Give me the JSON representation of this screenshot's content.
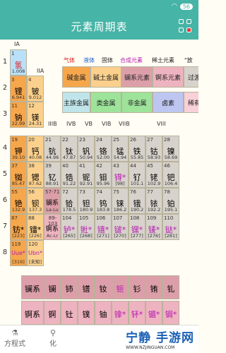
{
  "status_bar": {
    "time": "",
    "battery": "56"
  },
  "app": {
    "title": "元素周期表"
  },
  "legend": {
    "gas": "气体",
    "liquid": "液体",
    "solid": "固体",
    "synthetic": "合成元素",
    "rare_earth": "稀土元素",
    "radioactive": "\"放"
  },
  "colors": {
    "accent": "#46b4a6",
    "alkali": "#f6a64b",
    "alkaline_earth": "#fbd08c",
    "lanthanide": "#dc9fa9",
    "actinide": "#eeb3c0",
    "transition": "#d7d2cb",
    "poor_metal": "#bfe4ea",
    "nonmetal": "#9ee39a",
    "halogen": "#bdc6f0",
    "noble": "#f8d0d8",
    "hydrogen": "#b8e0f8"
  },
  "periods": [
    "1",
    "2",
    "3",
    "4",
    "5",
    "6",
    "7",
    "8"
  ],
  "groups": {
    "g1": "IA",
    "g2": "IIA",
    "g3": "IIIB",
    "g4": "IVB",
    "g5": "VB",
    "g6": "VIB",
    "g7": "VIIB",
    "g8": "VIII"
  },
  "categories": [
    "碱金属",
    "碱土金属",
    "镧系元素",
    "锕系元素",
    "过渡",
    "主族金属",
    "类金属",
    "非金属",
    "卤素",
    "稀有"
  ],
  "elements": [
    {
      "z": "1",
      "s": "氢",
      "m": "1.008"
    },
    {
      "z": "3",
      "s": "锂",
      "m": "6.941"
    },
    {
      "z": "4",
      "s": "铍",
      "m": "9.012"
    },
    {
      "z": "11",
      "s": "钠",
      "m": "22.99"
    },
    {
      "z": "12",
      "s": "镁",
      "m": "24.31"
    },
    {
      "z": "19",
      "s": "钾",
      "m": "39.10"
    },
    {
      "z": "20",
      "s": "钙",
      "m": "40.08"
    },
    {
      "z": "21",
      "s": "钪",
      "m": "44.96"
    },
    {
      "z": "22",
      "s": "钛",
      "m": "47.87"
    },
    {
      "z": "23",
      "s": "钒",
      "m": "50.94"
    },
    {
      "z": "24",
      "s": "铬",
      "m": "52.00"
    },
    {
      "z": "25",
      "s": "锰",
      "m": "54.94"
    },
    {
      "z": "26",
      "s": "铁",
      "m": "55.85"
    },
    {
      "z": "27",
      "s": "钴",
      "m": "58.93"
    },
    {
      "z": "28",
      "s": "镍",
      "m": "58.69"
    },
    {
      "z": "37",
      "s": "铷",
      "m": "85.47"
    },
    {
      "z": "38",
      "s": "锶",
      "m": "87.62"
    },
    {
      "z": "39",
      "s": "钇",
      "m": "88.91"
    },
    {
      "z": "40",
      "s": "锆",
      "m": "91.22"
    },
    {
      "z": "41",
      "s": "铌",
      "m": "92.91"
    },
    {
      "z": "42",
      "s": "钼",
      "m": "95.96"
    },
    {
      "z": "43",
      "s": "锝*",
      "m": "[98]"
    },
    {
      "z": "44",
      "s": "钌",
      "m": "101.1"
    },
    {
      "z": "45",
      "s": "铑",
      "m": "102.9"
    },
    {
      "z": "46",
      "s": "钯",
      "m": "106.4"
    },
    {
      "z": "55",
      "s": "铯",
      "m": "132.9"
    },
    {
      "z": "56",
      "s": "钡",
      "m": "137.3"
    },
    {
      "z": "57-71",
      "s": "镧系",
      "m": "La-Lu"
    },
    {
      "z": "72",
      "s": "铪",
      "m": "178.5"
    },
    {
      "z": "73",
      "s": "钽",
      "m": "180.9"
    },
    {
      "z": "74",
      "s": "钨",
      "m": "183.8"
    },
    {
      "z": "75",
      "s": "铼",
      "m": "186.2"
    },
    {
      "z": "76",
      "s": "锇",
      "m": "190.2"
    },
    {
      "z": "77",
      "s": "铱",
      "m": "192.2"
    },
    {
      "z": "78",
      "s": "铂",
      "m": "195.1"
    },
    {
      "z": "87",
      "s": "钫*",
      "m": "[223]"
    },
    {
      "z": "88",
      "s": "镭*",
      "m": "[226]"
    },
    {
      "z": "89-103",
      "s": "锕系",
      "m": "Ac-Lr"
    },
    {
      "z": "104",
      "s": "𬬻*",
      "m": "[265]"
    },
    {
      "z": "105",
      "s": "𬭊*",
      "m": "[268]"
    },
    {
      "z": "106",
      "s": "𬭳*",
      "m": "[271]"
    },
    {
      "z": "107",
      "s": "𬭛*",
      "m": "[270]"
    },
    {
      "z": "108",
      "s": "𬭶*",
      "m": "[277]"
    },
    {
      "z": "109",
      "s": "鿏*",
      "m": "[276]"
    },
    {
      "z": "110",
      "s": "𫟼*",
      "m": "[281]"
    },
    {
      "z": "119",
      "s": "Uue*",
      "m": "[319]"
    },
    {
      "z": "120",
      "s": "Ubn*",
      "m": "[未知]"
    }
  ],
  "lanthanides": [
    "镧系",
    "镧",
    "铈",
    "镨",
    "钕",
    "钷",
    "钐",
    "铕",
    "钆"
  ],
  "actinides": [
    "锕系",
    "锕",
    "钍",
    "镤",
    "铀",
    "镎*",
    "钚*",
    "镅*",
    "锔*"
  ],
  "bottom_tabs": [
    {
      "label": "方程式"
    },
    {
      "label": "化"
    }
  ],
  "watermark": {
    "title": "宁静 手游网",
    "url": "WWW.NZJINGUAN.COM"
  }
}
